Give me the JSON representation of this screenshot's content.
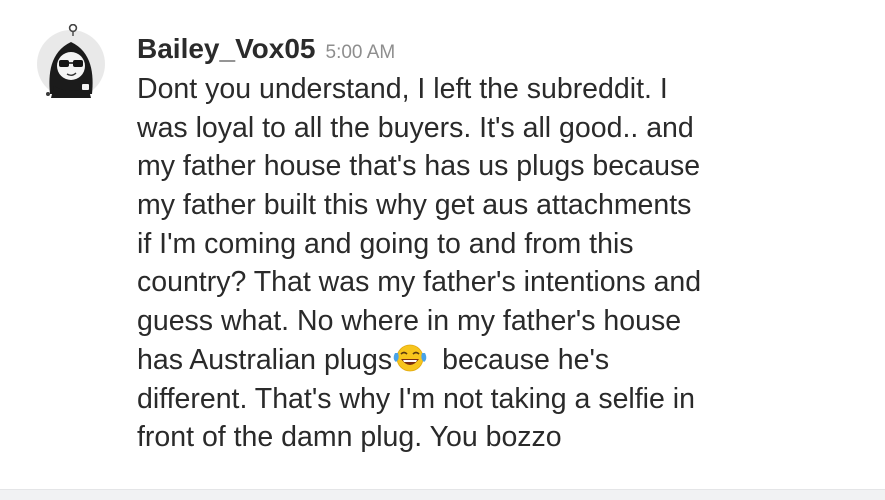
{
  "message": {
    "username": "Bailey_Vox05",
    "timestamp": "5:00 AM",
    "avatar_icon": "hooded-figure-with-sunglasses-icon",
    "lines": [
      "Dont you understand, I left the subreddit. I",
      "was loyal to all the buyers. It's all good.. and",
      "my father house that's has us plugs because",
      "my father built this why get aus attachments",
      "if I'm coming and going to and from this",
      "country? That was my father's intentions and",
      "guess what. No where in my father's house",
      "has Australian plugs",
      "because he's",
      "different. That's why I'm not taking a selfie in",
      "front of the damn plug. You bozzo"
    ],
    "emoji": "face-with-tears-of-joy-emoji"
  },
  "colors": {
    "username": "#2b2b2b",
    "timestamp": "#8e8e8e",
    "body_text": "#2a2a2a",
    "divider": "#f1f2f3",
    "emoji_yellow": "#f7c51c"
  }
}
